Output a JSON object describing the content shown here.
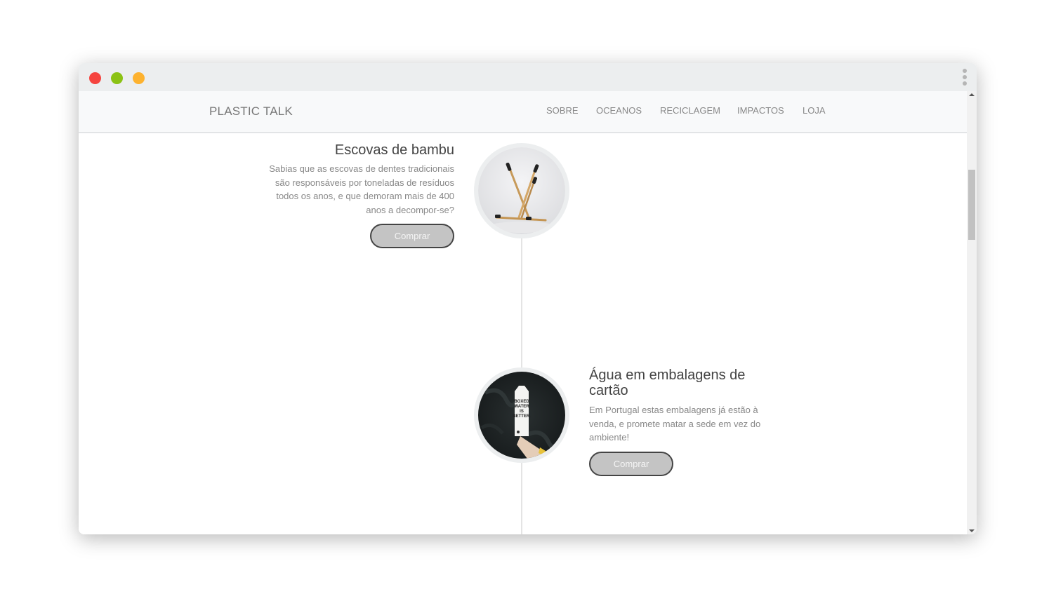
{
  "window": {
    "controls": [
      "close",
      "minimize",
      "maximize"
    ],
    "colors": {
      "close": "#f5443f",
      "minimize": "#8bc214",
      "maximize": "#fdb22f"
    }
  },
  "navbar": {
    "brand": "PLASTIC TALK",
    "items": [
      "SOBRE",
      "OCEANOS",
      "RECICLAGEM",
      "IMPACTOS",
      "LOJA"
    ]
  },
  "products": [
    {
      "title": "Escovas de bambu",
      "description_lines": [
        "Sabias que as escovas de dentes tradicionais",
        "são responsáveis por toneladas de resíduos",
        "todos os anos, e que demoram mais de 400",
        "anos a decompor-se?"
      ],
      "button": "Comprar",
      "image_icon": "bamboo-toothbrushes-image"
    },
    {
      "title_lines": [
        "Água em embalagens de",
        "cartão"
      ],
      "description_lines": [
        "Em Portugal estas embalagens já estão à",
        "venda, e promete matar a sede em vez do",
        "ambiente!"
      ],
      "button": "Comprar",
      "image_icon": "boxed-water-carton-image",
      "carton_text": [
        "BOXED",
        "WATER",
        "IS",
        "BETTER."
      ]
    }
  ]
}
